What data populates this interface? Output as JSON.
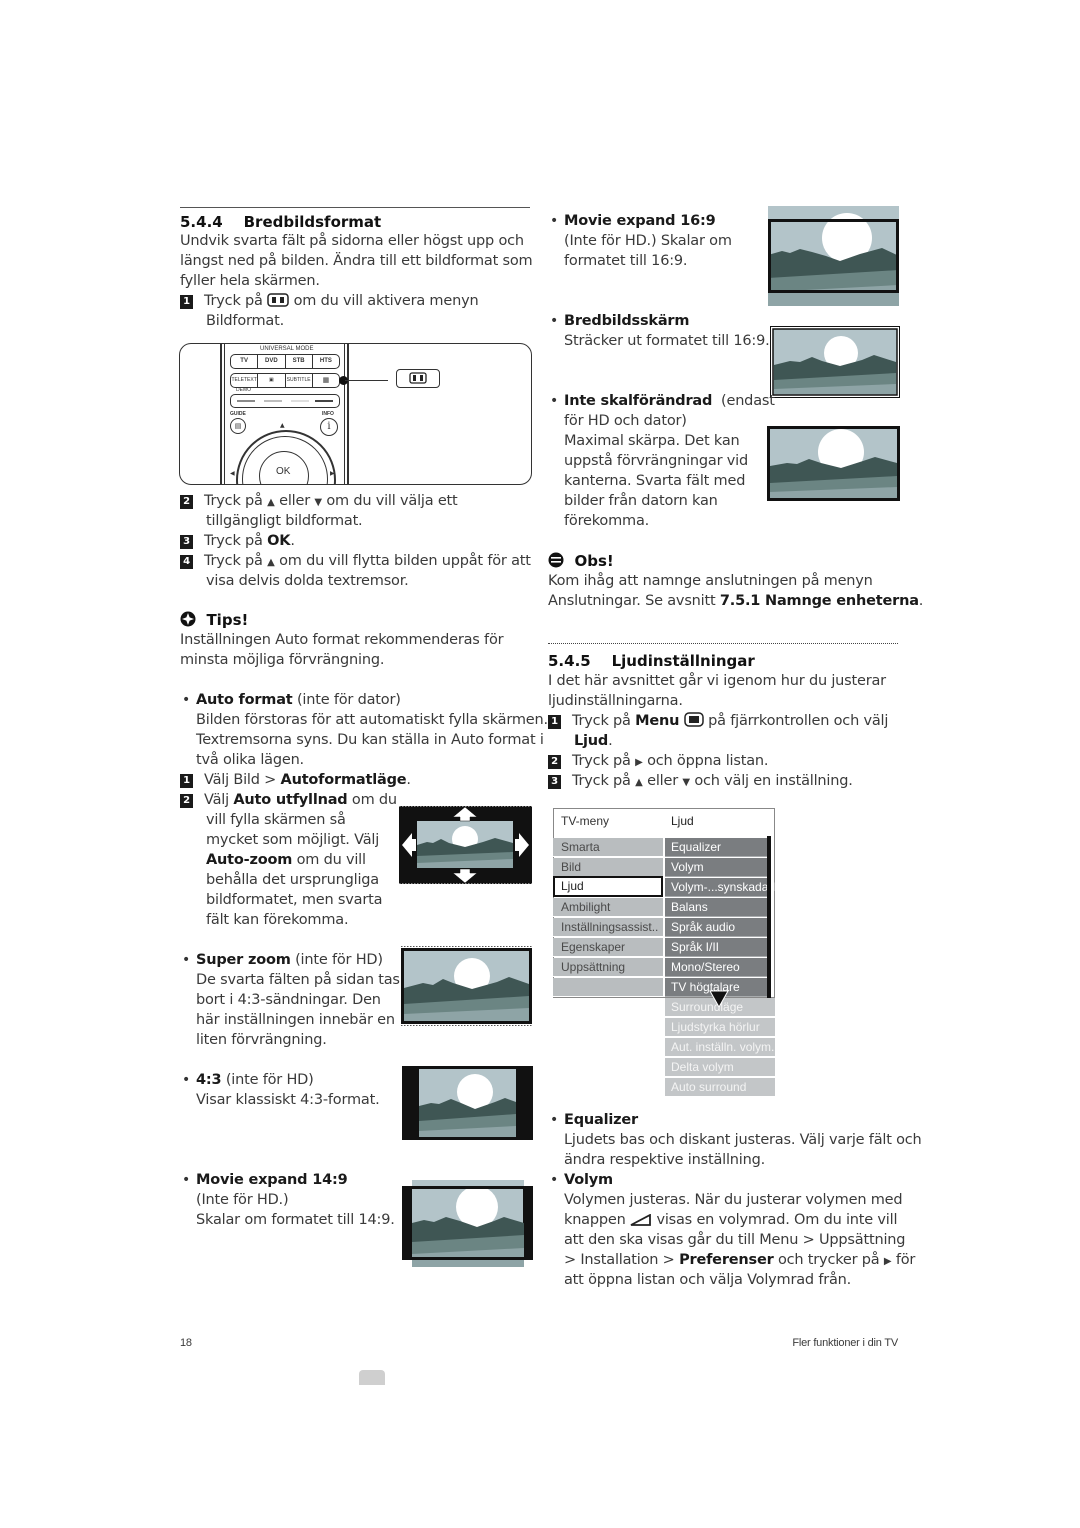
{
  "left": {
    "section_number": "5.4.4",
    "section_title": "Bredbildsformat",
    "intro": [
      "Undvik svarta fält på sidorna eller högst upp och",
      "längst ned på bilden. Ändra till ett bildformat som",
      "fyller hela skärmen."
    ],
    "steps": [
      {
        "n": "1",
        "pre": "Tryck på",
        "post": "om du vill aktivera menyn",
        "cont": "Bildformat."
      },
      {
        "n": "2",
        "pre": "Tryck på",
        "mid": "eller",
        "post": "om du vill välja ett",
        "cont": "tillgängligt bildformat."
      },
      {
        "n": "3",
        "pre": "Tryck på",
        "bold": "OK",
        "post": "."
      },
      {
        "n": "4",
        "pre": "Tryck på",
        "post": "om du vill flytta bilden uppåt för att",
        "cont": "visa delvis dolda textremsor."
      }
    ],
    "remote": {
      "universal_mode": "UNIVERSAL MODE",
      "buttons_row1": [
        "TV",
        "DVD",
        "STB",
        "HTS"
      ],
      "buttons_row2": [
        "TELETEXT",
        "",
        "SUBTITLE",
        ""
      ],
      "demo": "DEMO",
      "guide": "GUIDE",
      "info": "INFO",
      "ok": "OK",
      "colors": [
        "#8a8a8a",
        "#bdbdbd",
        "#dedede",
        "#555555"
      ]
    },
    "tips": {
      "title": "Tips!",
      "lines": [
        "Inställningen Auto format rekommenderas för",
        "minsta möjliga förvrängning."
      ]
    },
    "auto_format": {
      "title": "Auto format",
      "suffix": "(inte för dator)",
      "lines": [
        "Bilden förstoras för att automatiskt fylla skärmen.",
        "Textremsorna syns. Du kan ställa in Auto format i",
        "två olika lägen."
      ],
      "step1_pre": "Välj Bild >",
      "step1_bold": "Autoformatläge",
      "step1_post": ".",
      "step2_pre": "Välj",
      "step2_bold": "Auto utfyllnad",
      "step2_post": "om du",
      "step2_lines": [
        "vill fylla skärmen så",
        "mycket som möjligt. Välj"
      ],
      "step2_bold2": "Auto-zoom",
      "step2_post2": "om du vill",
      "step2_lines2": [
        "behålla det ursprungliga",
        "bildformatet, men svarta",
        "fält kan förekomma."
      ]
    },
    "super_zoom": {
      "title": "Super zoom",
      "suffix": "(inte för HD)",
      "lines": [
        "De svarta fälten på sidan tas",
        "bort i 4:3-sändningar. Den",
        "här inställningen innebär en",
        "liten förvrängning."
      ]
    },
    "four_three": {
      "title": "4:3",
      "suffix": "(inte för HD)",
      "lines": [
        "Visar klassiskt 4:3-format."
      ]
    },
    "movie149": {
      "title": "Movie expand 14:9",
      "lines": [
        "(Inte för HD.)",
        "Skalar om formatet till 14:9."
      ]
    }
  },
  "right": {
    "movie169": {
      "title": "Movie expand 16:9",
      "lines": [
        "(Inte för HD.) Skalar om",
        "formatet till 16:9."
      ]
    },
    "widescreen": {
      "title": "Bredbildsskärm",
      "lines": [
        "Sträcker ut formatet till 16:9."
      ]
    },
    "unscaled": {
      "title": "Inte skalförändrad",
      "suffix": "(endast",
      "lines": [
        "för HD och dator)",
        "Maximal skärpa. Det kan",
        "uppstå förvrängningar vid",
        "kanterna. Svarta fält med",
        "bilder från datorn kan",
        "förekomma."
      ]
    },
    "obs": {
      "title": "Obs!",
      "line1": "Kom ihåg att namnge anslutningen på menyn",
      "line2_pre": "Anslutningar. Se avsnitt",
      "line2_bold": "7.5.1 Namnge enheterna",
      "line2_post": "."
    },
    "section_number": "5.4.5",
    "section_title": "Ljudinställningar",
    "intro": [
      "I det här avsnittet går vi igenom hur du justerar",
      "ljudinställningarna."
    ],
    "steps": [
      {
        "n": "1",
        "pre": "Tryck på",
        "bold": "Menu",
        "post": "på fjärrkontrollen och välj",
        "cont_bold": "Ljud",
        "cont_post": "."
      },
      {
        "n": "2",
        "pre": "Tryck på",
        "post": "och öppna listan."
      },
      {
        "n": "3",
        "pre": "Tryck på",
        "mid": "eller",
        "post": "och välj en inställning."
      }
    ],
    "menu": {
      "header_left": "TV-meny",
      "header_right": "Ljud",
      "left_items": [
        "Smarta inställningar",
        "Bild",
        "Ljud",
        "Ambilight",
        "Inställningsassist..",
        "Egenskaper",
        "Uppsättning",
        ""
      ],
      "selected_left": "Ljud",
      "right_items": [
        "Equalizer",
        "Volym",
        "Volym-...synskadad",
        "Balans",
        "Språk audio",
        "Språk I/II",
        "Mono/Stereo",
        "TV högtalare"
      ],
      "right_items_faded": [
        "Surroundläge",
        "Ljudstyrka hörlur",
        "Aut. inställn. volym.",
        "Delta volym",
        "Auto surround"
      ]
    },
    "equalizer": {
      "title": "Equalizer",
      "lines": [
        "Ljudets bas och diskant justeras. Välj varje fält och",
        "ändra respektive inställning."
      ]
    },
    "volym": {
      "title": "Volym",
      "line1": "Volymen justeras. När du justerar volymen med",
      "line2_pre": "knappen",
      "line2_post": "visas en volymrad. Om du inte vill",
      "line3": "att den ska visas går du till Menu > Uppsättning",
      "line4_pre": "> Installation >",
      "line4_bold": "Preferenser",
      "line4_post": "och trycker på",
      "line4_end": "för",
      "line5": "att öppna listan och välja Volymrad från."
    }
  },
  "footer": {
    "page_number": "18",
    "chapter": "Fler funktioner i din TV"
  },
  "colors": {
    "sky": "#b3c4c9",
    "mountain": "#3f5654",
    "band": "#6b8583",
    "ground": "#8ea4a6",
    "sun": "#ffffff",
    "menu_dark": "#7a7d80",
    "menu_light": "#b9bdbf"
  }
}
